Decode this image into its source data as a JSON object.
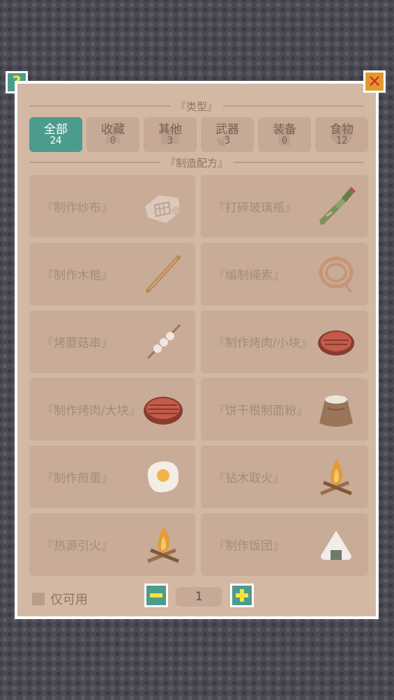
{
  "help_button": {
    "label": "?"
  },
  "close_button": {
    "label": "✕"
  },
  "sections": {
    "type_title": "『类型』",
    "recipe_title": "『制造配方』"
  },
  "tabs": [
    {
      "label": "全部",
      "count": "24",
      "active": true,
      "icon": "all-icon"
    },
    {
      "label": "收藏",
      "count": "0",
      "active": false,
      "icon": "star-icon"
    },
    {
      "label": "其他",
      "count": "3",
      "active": false,
      "icon": "box-icon"
    },
    {
      "label": "武器",
      "count": "3",
      "active": false,
      "icon": "sword-icon"
    },
    {
      "label": "装备",
      "count": "0",
      "active": false,
      "icon": "armor-icon"
    },
    {
      "label": "食物",
      "count": "12",
      "active": false,
      "icon": "food-icon"
    }
  ],
  "recipes": [
    {
      "label": "『制作纱布』",
      "icon": "gauze-icon"
    },
    {
      "label": "『打碎玻璃瓶』",
      "icon": "bottle-icon"
    },
    {
      "label": "『制作木棍』",
      "icon": "stick-icon"
    },
    {
      "label": "『编制绳索』",
      "icon": "rope-icon"
    },
    {
      "label": "『烤蘑菇串』",
      "icon": "mushroom-skewer-icon"
    },
    {
      "label": "『制作烤肉/小块』",
      "icon": "meat-icon"
    },
    {
      "label": "『制作烤肉/大块』",
      "icon": "big-meat-icon"
    },
    {
      "label": "『饼干根制面粉』",
      "icon": "flour-sack-icon"
    },
    {
      "label": "『制作煎蛋』",
      "icon": "fried-egg-icon"
    },
    {
      "label": "『钻木取火』",
      "icon": "campfire-icon"
    },
    {
      "label": "『热源引火』",
      "icon": "campfire-icon"
    },
    {
      "label": "『制作饭团』",
      "icon": "rice-ball-icon"
    }
  ],
  "footer": {
    "only_available_label": "仅可用",
    "only_available_checked": false,
    "quantity": "1"
  },
  "colors": {
    "panel": "#d3b8a4",
    "accent": "#4c9c8d",
    "card": "#c8ac98",
    "plus_yellow": "#f6e43a",
    "close_orange": "#e09a2c"
  }
}
